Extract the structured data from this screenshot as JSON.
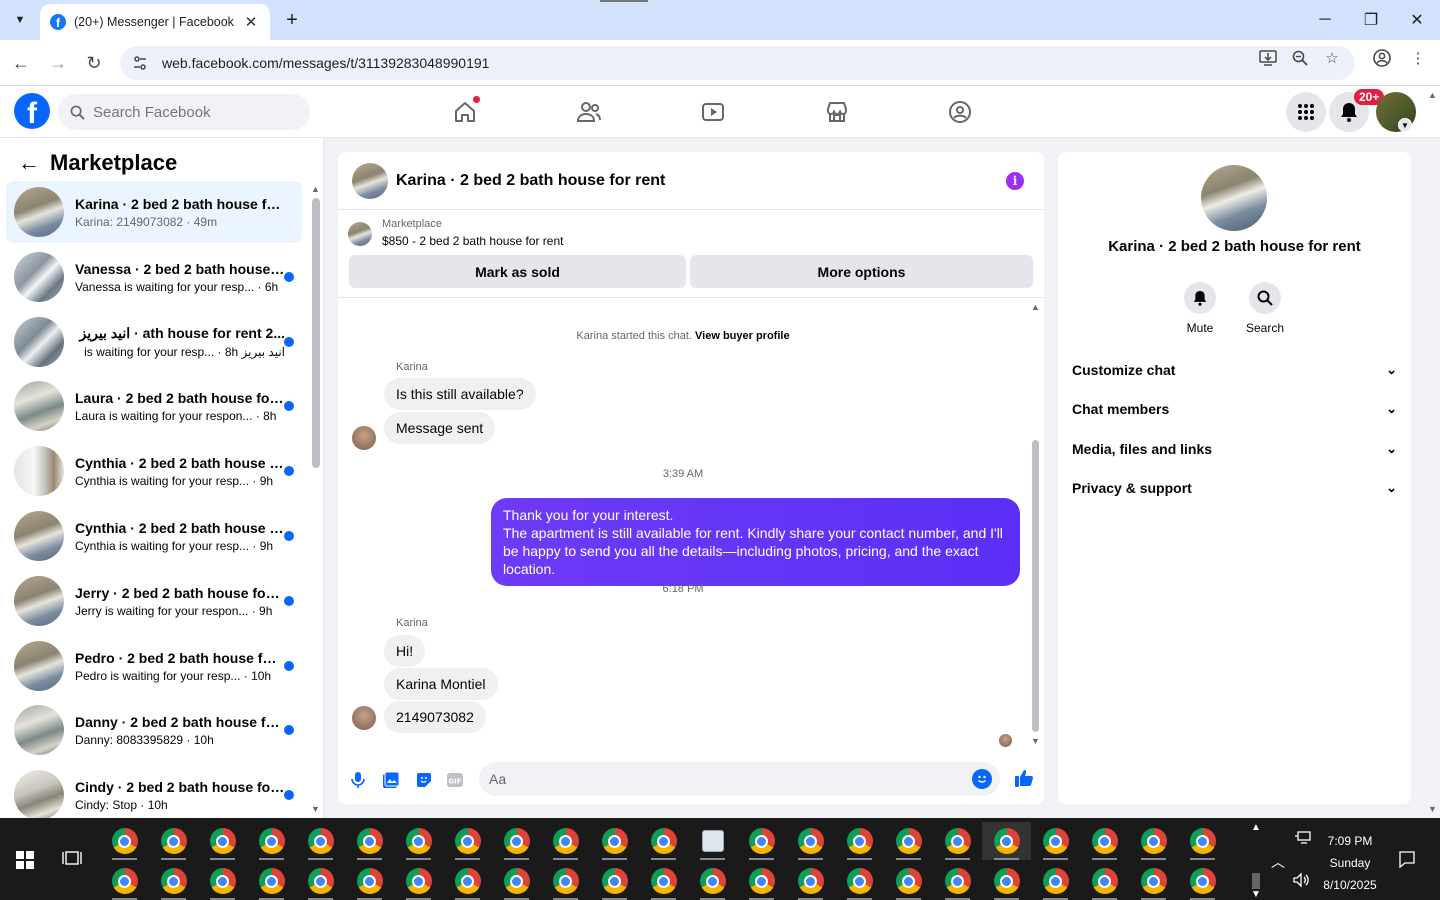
{
  "browser": {
    "tab_title": "(20+) Messenger | Facebook",
    "url": "web.facebook.com/messages/t/31139283048990191"
  },
  "facebook": {
    "search_placeholder": "Search Facebook",
    "notifications_badge": "20+"
  },
  "sidebar": {
    "title": "Marketplace",
    "conversations": [
      {
        "name": "Karina · 2 bed 2 bath house for r...",
        "preview": "Karina: 2149073082 · 49m",
        "unread": false,
        "active": true
      },
      {
        "name": "Vanessa · 2 bed 2 bath house f...",
        "preview": "Vanessa is waiting for your resp... · 6h",
        "unread": true,
        "active": false
      },
      {
        "name": "...ath house for rent 2 · انید بیریز",
        "preview": "انید بیریز is waiting for your resp... · 8h",
        "unread": true,
        "active": false
      },
      {
        "name": "Laura · 2 bed 2 bath house for...",
        "preview": "Laura is waiting for your respon... · 8h",
        "unread": true,
        "active": false
      },
      {
        "name": "Cynthia · 2 bed 2 bath house f...",
        "preview": "Cynthia is waiting for your resp... · 9h",
        "unread": true,
        "active": false
      },
      {
        "name": "Cynthia · 2 bed 2 bath house f...",
        "preview": "Cynthia is waiting for your resp... · 9h",
        "unread": true,
        "active": false
      },
      {
        "name": "Jerry · 2 bed 2 bath house for ...",
        "preview": "Jerry is waiting for your respon... · 9h",
        "unread": true,
        "active": false
      },
      {
        "name": "Pedro · 2 bed 2 bath house for...",
        "preview": "Pedro is waiting for your resp... · 10h",
        "unread": true,
        "active": false
      },
      {
        "name": "Danny · 2 bed 2 bath house fo...",
        "preview": "Danny: 8083395829 · 10h",
        "unread": true,
        "active": false
      },
      {
        "name": "Cindy · 2 bed 2 bath house for...",
        "preview": "Cindy: Stop · 10h",
        "unread": true,
        "active": false
      }
    ]
  },
  "chat": {
    "title": "Karina · 2 bed 2 bath house for rent",
    "listing_source": "Marketplace",
    "listing_price_title": "$850 - 2 bed 2 bath house for rent",
    "mark_sold": "Mark as sold",
    "more_options": "More options",
    "started_note": "Karina started this chat.",
    "view_buyer": "View buyer profile",
    "sender_name": "Karina",
    "msg1": "Is this still available?",
    "msg2": "Message sent",
    "time1": "3:39 AM",
    "mine_l1": "Thank you for your interest.",
    "mine_l2": "The apartment is still available for rent. Kindly share your contact number, and I'll be happy to send you all the details—including photos, pricing, and the exact location.",
    "time2": "6:18 PM",
    "msg3": "Hi!",
    "msg4": "Karina Montiel",
    "msg5": "2149073082",
    "composer_placeholder": "Aa"
  },
  "info_panel": {
    "name": "Karina · 2 bed 2 bath house for rent",
    "mute": "Mute",
    "search": "Search",
    "sections": [
      "Customize chat",
      "Chat members",
      "Media, files and links",
      "Privacy & support"
    ]
  },
  "taskbar": {
    "time": "7:09 PM",
    "day": "Sunday",
    "date": "8/10/2025"
  },
  "colors": {
    "fb_blue": "#0866ff",
    "message_purple": "#5b2ff7",
    "unread_dot": "#0866ff",
    "badge_red": "#e41e3f"
  }
}
